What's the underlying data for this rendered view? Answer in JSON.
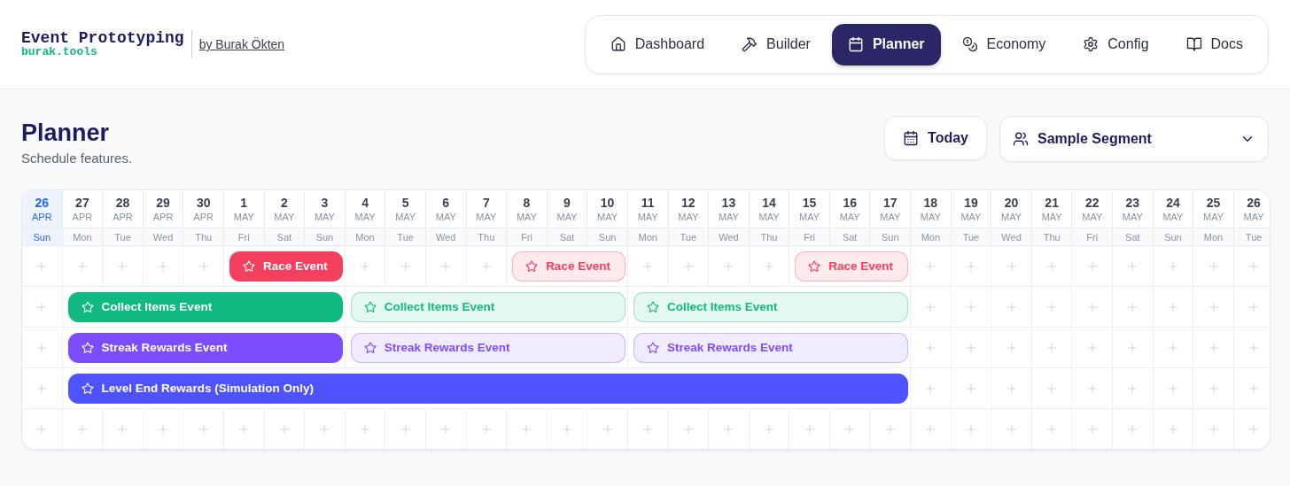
{
  "brand": {
    "title": "Event Prototyping",
    "subtitle": "burak.tools",
    "author": "by Burak Ökten"
  },
  "nav": [
    {
      "label": "Dashboard",
      "selected": false
    },
    {
      "label": "Builder",
      "selected": false
    },
    {
      "label": "Planner",
      "selected": true
    },
    {
      "label": "Economy",
      "selected": false
    },
    {
      "label": "Config",
      "selected": false
    },
    {
      "label": "Docs",
      "selected": false
    }
  ],
  "page": {
    "title": "Planner",
    "subtitle": "Schedule features."
  },
  "today_button": "Today",
  "segment_select": {
    "value": "Sample Segment"
  },
  "calendar": {
    "days": [
      {
        "date": "26",
        "month": "APR",
        "weekday": "Sun",
        "today": true
      },
      {
        "date": "27",
        "month": "APR",
        "weekday": "Mon",
        "today": false
      },
      {
        "date": "28",
        "month": "APR",
        "weekday": "Tue",
        "today": false
      },
      {
        "date": "29",
        "month": "APR",
        "weekday": "Wed",
        "today": false
      },
      {
        "date": "30",
        "month": "APR",
        "weekday": "Thu",
        "today": false
      },
      {
        "date": "1",
        "month": "MAY",
        "weekday": "Fri",
        "today": false
      },
      {
        "date": "2",
        "month": "MAY",
        "weekday": "Sat",
        "today": false
      },
      {
        "date": "3",
        "month": "MAY",
        "weekday": "Sun",
        "today": false
      },
      {
        "date": "4",
        "month": "MAY",
        "weekday": "Mon",
        "today": false
      },
      {
        "date": "5",
        "month": "MAY",
        "weekday": "Tue",
        "today": false
      },
      {
        "date": "6",
        "month": "MAY",
        "weekday": "Wed",
        "today": false
      },
      {
        "date": "7",
        "month": "MAY",
        "weekday": "Thu",
        "today": false
      },
      {
        "date": "8",
        "month": "MAY",
        "weekday": "Fri",
        "today": false
      },
      {
        "date": "9",
        "month": "MAY",
        "weekday": "Sat",
        "today": false
      },
      {
        "date": "10",
        "month": "MAY",
        "weekday": "Sun",
        "today": false
      },
      {
        "date": "11",
        "month": "MAY",
        "weekday": "Mon",
        "today": false
      },
      {
        "date": "12",
        "month": "MAY",
        "weekday": "Tue",
        "today": false
      },
      {
        "date": "13",
        "month": "MAY",
        "weekday": "Wed",
        "today": false
      },
      {
        "date": "14",
        "month": "MAY",
        "weekday": "Thu",
        "today": false
      },
      {
        "date": "15",
        "month": "MAY",
        "weekday": "Fri",
        "today": false
      },
      {
        "date": "16",
        "month": "MAY",
        "weekday": "Sat",
        "today": false
      },
      {
        "date": "17",
        "month": "MAY",
        "weekday": "Sun",
        "today": false
      },
      {
        "date": "18",
        "month": "MAY",
        "weekday": "Mon",
        "today": false
      },
      {
        "date": "19",
        "month": "MAY",
        "weekday": "Tue",
        "today": false
      },
      {
        "date": "20",
        "month": "MAY",
        "weekday": "Wed",
        "today": false
      },
      {
        "date": "21",
        "month": "MAY",
        "weekday": "Thu",
        "today": false
      },
      {
        "date": "22",
        "month": "MAY",
        "weekday": "Fri",
        "today": false
      },
      {
        "date": "23",
        "month": "MAY",
        "weekday": "Sat",
        "today": false
      },
      {
        "date": "24",
        "month": "MAY",
        "weekday": "Sun",
        "today": false
      },
      {
        "date": "25",
        "month": "MAY",
        "weekday": "Mon",
        "today": false
      },
      {
        "date": "26",
        "month": "MAY",
        "weekday": "Tue",
        "today": false
      }
    ],
    "rows": [
      {
        "slots": [
          {
            "kind": "empty"
          },
          {
            "kind": "empty"
          },
          {
            "kind": "empty"
          },
          {
            "kind": "empty"
          },
          {
            "kind": "empty"
          },
          {
            "kind": "event",
            "label": "Race Event",
            "color": "#f43f5e",
            "highlighted": true
          },
          {
            "kind": "continued"
          },
          {
            "kind": "continued"
          },
          {
            "kind": "empty"
          },
          {
            "kind": "empty"
          },
          {
            "kind": "empty"
          },
          {
            "kind": "empty"
          },
          {
            "kind": "event",
            "label": "Race Event",
            "color": "#f43f5e",
            "highlighted": false
          },
          {
            "kind": "continued"
          },
          {
            "kind": "continued"
          },
          {
            "kind": "empty"
          },
          {
            "kind": "empty"
          },
          {
            "kind": "empty"
          },
          {
            "kind": "empty"
          },
          {
            "kind": "event",
            "label": "Race Event",
            "color": "#f43f5e",
            "highlighted": false
          },
          {
            "kind": "continued"
          },
          {
            "kind": "continued"
          },
          {
            "kind": "empty"
          },
          {
            "kind": "empty"
          },
          {
            "kind": "empty"
          },
          {
            "kind": "empty"
          },
          {
            "kind": "empty"
          },
          {
            "kind": "empty"
          },
          {
            "kind": "empty"
          },
          {
            "kind": "empty"
          },
          {
            "kind": "empty"
          }
        ]
      },
      {
        "slots": [
          {
            "kind": "empty"
          },
          {
            "kind": "event",
            "label": "Collect Items Event",
            "color": "#10b981",
            "highlighted": true
          },
          {
            "kind": "continued"
          },
          {
            "kind": "continued"
          },
          {
            "kind": "continued"
          },
          {
            "kind": "continued"
          },
          {
            "kind": "continued"
          },
          {
            "kind": "continued"
          },
          {
            "kind": "event",
            "label": "Collect Items Event",
            "color": "#10b981",
            "highlighted": false
          },
          {
            "kind": "continued"
          },
          {
            "kind": "continued"
          },
          {
            "kind": "continued"
          },
          {
            "kind": "continued"
          },
          {
            "kind": "continued"
          },
          {
            "kind": "continued"
          },
          {
            "kind": "event",
            "label": "Collect Items Event",
            "color": "#10b981",
            "highlighted": false
          },
          {
            "kind": "continued"
          },
          {
            "kind": "continued"
          },
          {
            "kind": "continued"
          },
          {
            "kind": "continued"
          },
          {
            "kind": "continued"
          },
          {
            "kind": "continued"
          },
          {
            "kind": "empty"
          },
          {
            "kind": "empty"
          },
          {
            "kind": "empty"
          },
          {
            "kind": "empty"
          },
          {
            "kind": "empty"
          },
          {
            "kind": "empty"
          },
          {
            "kind": "empty"
          },
          {
            "kind": "empty"
          },
          {
            "kind": "empty"
          }
        ]
      },
      {
        "slots": [
          {
            "kind": "empty"
          },
          {
            "kind": "event",
            "label": "Streak Rewards Event",
            "color": "#7c4dff",
            "highlighted": true
          },
          {
            "kind": "continued"
          },
          {
            "kind": "continued"
          },
          {
            "kind": "continued"
          },
          {
            "kind": "continued"
          },
          {
            "kind": "continued"
          },
          {
            "kind": "continued"
          },
          {
            "kind": "event",
            "label": "Streak Rewards Event",
            "color": "#7c4dff",
            "highlighted": false
          },
          {
            "kind": "continued"
          },
          {
            "kind": "continued"
          },
          {
            "kind": "continued"
          },
          {
            "kind": "continued"
          },
          {
            "kind": "continued"
          },
          {
            "kind": "continued"
          },
          {
            "kind": "event",
            "label": "Streak Rewards Event",
            "color": "#7c4dff",
            "highlighted": false
          },
          {
            "kind": "continued"
          },
          {
            "kind": "continued"
          },
          {
            "kind": "continued"
          },
          {
            "kind": "continued"
          },
          {
            "kind": "continued"
          },
          {
            "kind": "continued"
          },
          {
            "kind": "empty"
          },
          {
            "kind": "empty"
          },
          {
            "kind": "empty"
          },
          {
            "kind": "empty"
          },
          {
            "kind": "empty"
          },
          {
            "kind": "empty"
          },
          {
            "kind": "empty"
          },
          {
            "kind": "empty"
          },
          {
            "kind": "empty"
          }
        ]
      },
      {
        "slots": [
          {
            "kind": "empty"
          },
          {
            "kind": "event",
            "label": "Level End Rewards (Simulation Only)",
            "color": "#4f52ff",
            "highlighted": true
          },
          {
            "kind": "continued"
          },
          {
            "kind": "continued"
          },
          {
            "kind": "continued"
          },
          {
            "kind": "continued"
          },
          {
            "kind": "continued"
          },
          {
            "kind": "continued"
          },
          {
            "kind": "continued"
          },
          {
            "kind": "continued"
          },
          {
            "kind": "continued"
          },
          {
            "kind": "continued"
          },
          {
            "kind": "continued"
          },
          {
            "kind": "continued"
          },
          {
            "kind": "continued"
          },
          {
            "kind": "continued"
          },
          {
            "kind": "continued"
          },
          {
            "kind": "continued"
          },
          {
            "kind": "continued"
          },
          {
            "kind": "continued"
          },
          {
            "kind": "continued"
          },
          {
            "kind": "continued"
          },
          {
            "kind": "empty"
          },
          {
            "kind": "empty"
          },
          {
            "kind": "empty"
          },
          {
            "kind": "empty"
          },
          {
            "kind": "empty"
          },
          {
            "kind": "empty"
          },
          {
            "kind": "empty"
          },
          {
            "kind": "empty"
          },
          {
            "kind": "empty"
          }
        ]
      },
      {
        "slots": [
          {
            "kind": "empty"
          },
          {
            "kind": "empty"
          },
          {
            "kind": "empty"
          },
          {
            "kind": "empty"
          },
          {
            "kind": "empty"
          },
          {
            "kind": "empty"
          },
          {
            "kind": "empty"
          },
          {
            "kind": "empty"
          },
          {
            "kind": "empty"
          },
          {
            "kind": "empty"
          },
          {
            "kind": "empty"
          },
          {
            "kind": "empty"
          },
          {
            "kind": "empty"
          },
          {
            "kind": "empty"
          },
          {
            "kind": "empty"
          },
          {
            "kind": "empty"
          },
          {
            "kind": "empty"
          },
          {
            "kind": "empty"
          },
          {
            "kind": "empty"
          },
          {
            "kind": "empty"
          },
          {
            "kind": "empty"
          },
          {
            "kind": "empty"
          },
          {
            "kind": "empty"
          },
          {
            "kind": "empty"
          },
          {
            "kind": "empty"
          },
          {
            "kind": "empty"
          },
          {
            "kind": "empty"
          },
          {
            "kind": "empty"
          },
          {
            "kind": "empty"
          },
          {
            "kind": "empty"
          },
          {
            "kind": "empty"
          }
        ]
      }
    ]
  }
}
